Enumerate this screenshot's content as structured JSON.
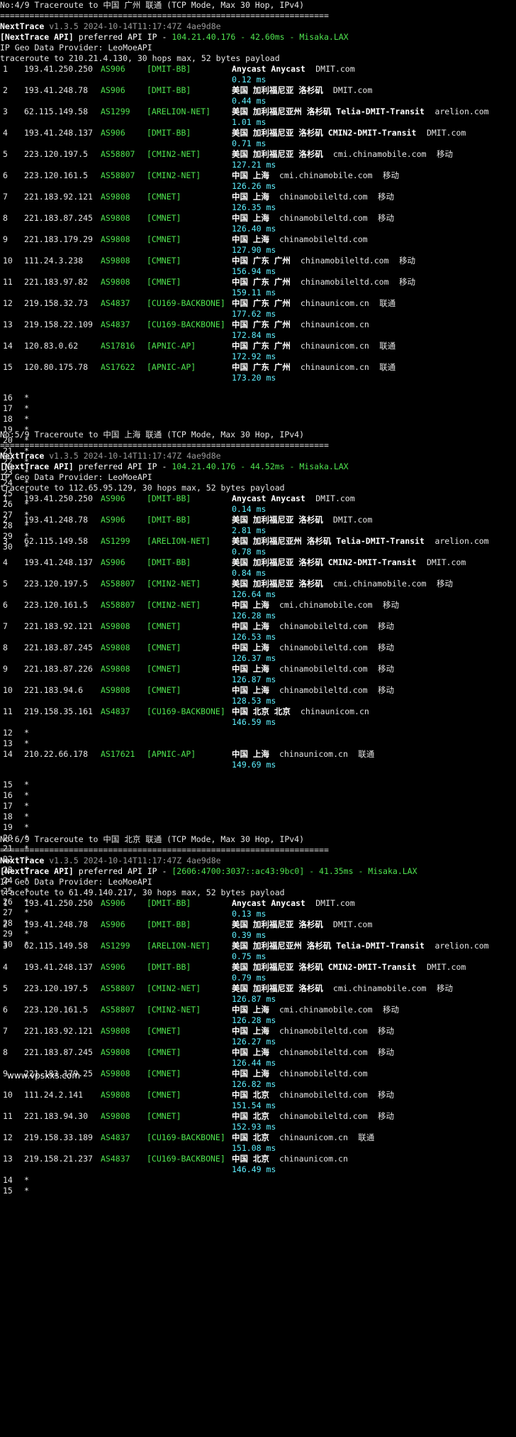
{
  "watermark": "www.vpsxxs.com",
  "traces": [
    {
      "title": "No:4/9 Traceroute to 中国 广州 联通 (TCP Mode, Max 30 Hop, IPv4)",
      "rule": "===================================================================",
      "brand": "NextTrace",
      "version": " v1.3.5 2024-10-14T11:17:47Z 4ae9d8e",
      "api_prefix": "[NextTrace API] preferred API IP - ",
      "api_ip": "104.21.40.176 - 42.60ms - Misaka.LAX",
      "geo_provider": "IP Geo Data Provider: LeoMoeAPI",
      "traceroute": "traceroute to 210.21.4.130, 30 hops max, 52 bytes payload",
      "hops": [
        {
          "n": "1",
          "ip": "193.41.250.250",
          "as": "AS906",
          "net": "[DMIT-BB]",
          "geo": "Anycast Anycast",
          "dom": "DMIT.com",
          "isp": "",
          "rtt": "0.12 ms"
        },
        {
          "n": "2",
          "ip": "193.41.248.78",
          "as": "AS906",
          "net": "[DMIT-BB]",
          "geo": "美国 加利福尼亚 洛杉矶",
          "dom": "DMIT.com",
          "isp": "",
          "rtt": "0.44 ms"
        },
        {
          "n": "3",
          "ip": "62.115.149.58",
          "as": "AS1299",
          "net": "[ARELION-NET]",
          "geo": "美国 加利福尼亚州 洛杉矶 Telia-DMIT-Transit",
          "dom": "arelion.com",
          "isp": "",
          "rtt": "1.01 ms"
        },
        {
          "n": "4",
          "ip": "193.41.248.137",
          "as": "AS906",
          "net": "[DMIT-BB]",
          "geo": "美国 加利福尼亚 洛杉矶 CMIN2-DMIT-Transit",
          "dom": "DMIT.com",
          "isp": "",
          "rtt": "0.71 ms"
        },
        {
          "n": "5",
          "ip": "223.120.197.5",
          "as": "AS58807",
          "net": "[CMIN2-NET]",
          "geo": "美国 加利福尼亚 洛杉矶",
          "dom": "cmi.chinamobile.com",
          "isp": "移动",
          "rtt": "127.21 ms"
        },
        {
          "n": "6",
          "ip": "223.120.161.5",
          "as": "AS58807",
          "net": "[CMIN2-NET]",
          "geo": "中国 上海",
          "dom": "cmi.chinamobile.com",
          "isp": "移动",
          "rtt": "126.26 ms"
        },
        {
          "n": "7",
          "ip": "221.183.92.121",
          "as": "AS9808",
          "net": "[CMNET]",
          "geo": "中国 上海",
          "dom": "chinamobileltd.com",
          "isp": "移动",
          "rtt": "126.35 ms"
        },
        {
          "n": "8",
          "ip": "221.183.87.245",
          "as": "AS9808",
          "net": "[CMNET]",
          "geo": "中国 上海",
          "dom": "chinamobileltd.com",
          "isp": "移动",
          "rtt": "126.40 ms"
        },
        {
          "n": "9",
          "ip": "221.183.179.29",
          "as": "AS9808",
          "net": "[CMNET]",
          "geo": "中国 上海",
          "dom": "chinamobileltd.com",
          "isp": "",
          "rtt": "127.90 ms"
        },
        {
          "n": "10",
          "ip": "111.24.3.238",
          "as": "AS9808",
          "net": "[CMNET]",
          "geo": "中国 广东 广州",
          "dom": "chinamobileltd.com",
          "isp": "移动",
          "rtt": "156.94 ms"
        },
        {
          "n": "11",
          "ip": "221.183.97.82",
          "as": "AS9808",
          "net": "[CMNET]",
          "geo": "中国 广东 广州",
          "dom": "chinamobileltd.com",
          "isp": "移动",
          "rtt": "159.11 ms"
        },
        {
          "n": "12",
          "ip": "219.158.32.73",
          "as": "AS4837",
          "net": "[CU169-BACKBONE]",
          "geo": "中国 广东 广州",
          "dom": "chinaunicom.cn",
          "isp": "联通",
          "rtt": "177.62 ms"
        },
        {
          "n": "13",
          "ip": "219.158.22.109",
          "as": "AS4837",
          "net": "[CU169-BACKBONE]",
          "geo": "中国 广东 广州",
          "dom": "chinaunicom.cn",
          "isp": "",
          "rtt": "172.84 ms"
        },
        {
          "n": "14",
          "ip": "120.83.0.62",
          "as": "AS17816",
          "net": "[APNIC-AP]",
          "geo": "中国 广东 广州",
          "dom": "chinaunicom.cn",
          "isp": "联通",
          "rtt": "172.92 ms"
        },
        {
          "n": "15",
          "ip": "120.80.175.78",
          "as": "AS17622",
          "net": "[APNIC-AP]",
          "geo": "中国 广东 广州",
          "dom": "chinaunicom.cn",
          "isp": "联通",
          "rtt": "173.20 ms"
        }
      ],
      "stars": [
        "16",
        "17",
        "18",
        "19",
        "20",
        "21",
        "22",
        "23",
        "24",
        "25",
        "26",
        "27",
        "28",
        "29",
        "30"
      ]
    },
    {
      "title": "No:5/9 Traceroute to 中国 上海 联通 (TCP Mode, Max 30 Hop, IPv4)",
      "rule": "===================================================================",
      "brand": "NextTrace",
      "version": " v1.3.5 2024-10-14T11:17:47Z 4ae9d8e",
      "api_prefix": "[NextTrace API] preferred API IP - ",
      "api_ip": "104.21.40.176 - 44.52ms - Misaka.LAX",
      "geo_provider": "IP Geo Data Provider: LeoMoeAPI",
      "traceroute": "traceroute to 112.65.95.129, 30 hops max, 52 bytes payload",
      "hops": [
        {
          "n": "1",
          "ip": "193.41.250.250",
          "as": "AS906",
          "net": "[DMIT-BB]",
          "geo": "Anycast Anycast",
          "dom": "DMIT.com",
          "isp": "",
          "rtt": "0.14 ms"
        },
        {
          "n": "2",
          "ip": "193.41.248.78",
          "as": "AS906",
          "net": "[DMIT-BB]",
          "geo": "美国 加利福尼亚 洛杉矶",
          "dom": "DMIT.com",
          "isp": "",
          "rtt": "2.81 ms"
        },
        {
          "n": "3",
          "ip": "62.115.149.58",
          "as": "AS1299",
          "net": "[ARELION-NET]",
          "geo": "美国 加利福尼亚州 洛杉矶 Telia-DMIT-Transit",
          "dom": "arelion.com",
          "isp": "",
          "rtt": "0.78 ms"
        },
        {
          "n": "4",
          "ip": "193.41.248.137",
          "as": "AS906",
          "net": "[DMIT-BB]",
          "geo": "美国 加利福尼亚 洛杉矶 CMIN2-DMIT-Transit",
          "dom": "DMIT.com",
          "isp": "",
          "rtt": "0.84 ms"
        },
        {
          "n": "5",
          "ip": "223.120.197.5",
          "as": "AS58807",
          "net": "[CMIN2-NET]",
          "geo": "美国 加利福尼亚 洛杉矶",
          "dom": "cmi.chinamobile.com",
          "isp": "移动",
          "rtt": "126.64 ms"
        },
        {
          "n": "6",
          "ip": "223.120.161.5",
          "as": "AS58807",
          "net": "[CMIN2-NET]",
          "geo": "中国 上海",
          "dom": "cmi.chinamobile.com",
          "isp": "移动",
          "rtt": "126.28 ms"
        },
        {
          "n": "7",
          "ip": "221.183.92.121",
          "as": "AS9808",
          "net": "[CMNET]",
          "geo": "中国 上海",
          "dom": "chinamobileltd.com",
          "isp": "移动",
          "rtt": "126.53 ms"
        },
        {
          "n": "8",
          "ip": "221.183.87.245",
          "as": "AS9808",
          "net": "[CMNET]",
          "geo": "中国 上海",
          "dom": "chinamobileltd.com",
          "isp": "移动",
          "rtt": "126.37 ms"
        },
        {
          "n": "9",
          "ip": "221.183.87.226",
          "as": "AS9808",
          "net": "[CMNET]",
          "geo": "中国 上海",
          "dom": "chinamobileltd.com",
          "isp": "移动",
          "rtt": "126.87 ms"
        },
        {
          "n": "10",
          "ip": "221.183.94.6",
          "as": "AS9808",
          "net": "[CMNET]",
          "geo": "中国 上海",
          "dom": "chinamobileltd.com",
          "isp": "移动",
          "rtt": "128.53 ms"
        },
        {
          "n": "11",
          "ip": "219.158.35.161",
          "as": "AS4837",
          "net": "[CU169-BACKBONE]",
          "geo": "中国 北京 北京",
          "dom": "chinaunicom.cn",
          "isp": "",
          "rtt": "146.59 ms"
        }
      ],
      "stars_mid": [
        "12",
        "13"
      ],
      "hops2": [
        {
          "n": "14",
          "ip": "210.22.66.178",
          "as": "AS17621",
          "net": "[APNIC-AP]",
          "geo": "中国 上海",
          "dom": "chinaunicom.cn",
          "isp": "联通",
          "rtt": "149.69 ms"
        }
      ],
      "stars": [
        "15",
        "16",
        "17",
        "18",
        "19",
        "20",
        "21",
        "22",
        "23",
        "24",
        "25",
        "26",
        "27",
        "28",
        "29",
        "30"
      ]
    },
    {
      "title": "No:6/9 Traceroute to 中国 北京 联通 (TCP Mode, Max 30 Hop, IPv4)",
      "rule": "===================================================================",
      "brand": "NextTrace",
      "version": " v1.3.5 2024-10-14T11:17:47Z 4ae9d8e",
      "api_prefix": "[NextTrace API] preferred API IP - ",
      "api_ip": "[2606:4700:3037::ac43:9bc0] - 41.35ms - Misaka.LAX",
      "geo_provider": "IP Geo Data Provider: LeoMoeAPI",
      "traceroute": "traceroute to 61.49.140.217, 30 hops max, 52 bytes payload",
      "hops": [
        {
          "n": "1",
          "ip": "193.41.250.250",
          "as": "AS906",
          "net": "[DMIT-BB]",
          "geo": "Anycast Anycast",
          "dom": "DMIT.com",
          "isp": "",
          "rtt": "0.13 ms"
        },
        {
          "n": "2",
          "ip": "193.41.248.78",
          "as": "AS906",
          "net": "[DMIT-BB]",
          "geo": "美国 加利福尼亚 洛杉矶",
          "dom": "DMIT.com",
          "isp": "",
          "rtt": "0.39 ms"
        },
        {
          "n": "3",
          "ip": "62.115.149.58",
          "as": "AS1299",
          "net": "[ARELION-NET]",
          "geo": "美国 加利福尼亚州 洛杉矶 Telia-DMIT-Transit",
          "dom": "arelion.com",
          "isp": "",
          "rtt": "0.75 ms"
        },
        {
          "n": "4",
          "ip": "193.41.248.137",
          "as": "AS906",
          "net": "[DMIT-BB]",
          "geo": "美国 加利福尼亚 洛杉矶 CMIN2-DMIT-Transit",
          "dom": "DMIT.com",
          "isp": "",
          "rtt": "0.79 ms"
        },
        {
          "n": "5",
          "ip": "223.120.197.5",
          "as": "AS58807",
          "net": "[CMIN2-NET]",
          "geo": "美国 加利福尼亚 洛杉矶",
          "dom": "cmi.chinamobile.com",
          "isp": "移动",
          "rtt": "126.87 ms"
        },
        {
          "n": "6",
          "ip": "223.120.161.5",
          "as": "AS58807",
          "net": "[CMIN2-NET]",
          "geo": "中国 上海",
          "dom": "cmi.chinamobile.com",
          "isp": "移动",
          "rtt": "126.28 ms"
        },
        {
          "n": "7",
          "ip": "221.183.92.121",
          "as": "AS9808",
          "net": "[CMNET]",
          "geo": "中国 上海",
          "dom": "chinamobileltd.com",
          "isp": "移动",
          "rtt": "126.27 ms"
        },
        {
          "n": "8",
          "ip": "221.183.87.245",
          "as": "AS9808",
          "net": "[CMNET]",
          "geo": "中国 上海",
          "dom": "chinamobileltd.com",
          "isp": "移动",
          "rtt": "126.44 ms"
        },
        {
          "n": "9",
          "ip": "221.183.179.25",
          "as": "AS9808",
          "net": "[CMNET]",
          "geo": "中国 上海",
          "dom": "chinamobileltd.com",
          "isp": "",
          "rtt": "126.82 ms"
        },
        {
          "n": "10",
          "ip": "111.24.2.141",
          "as": "AS9808",
          "net": "[CMNET]",
          "geo": "中国 北京",
          "dom": "chinamobileltd.com",
          "isp": "移动",
          "rtt": "151.54 ms"
        },
        {
          "n": "11",
          "ip": "221.183.94.30",
          "as": "AS9808",
          "net": "[CMNET]",
          "geo": "中国 北京",
          "dom": "chinamobileltd.com",
          "isp": "移动",
          "rtt": "152.93 ms"
        },
        {
          "n": "12",
          "ip": "219.158.33.189",
          "as": "AS4837",
          "net": "[CU169-BACKBONE]",
          "geo": "中国 北京",
          "dom": "chinaunicom.cn",
          "isp": "联通",
          "rtt": "151.08 ms"
        },
        {
          "n": "13",
          "ip": "219.158.21.237",
          "as": "AS4837",
          "net": "[CU169-BACKBONE]",
          "geo": "中国 北京",
          "dom": "chinaunicom.cn",
          "isp": "",
          "rtt": "146.49 ms"
        }
      ],
      "stars": [
        "14",
        "15"
      ]
    }
  ]
}
